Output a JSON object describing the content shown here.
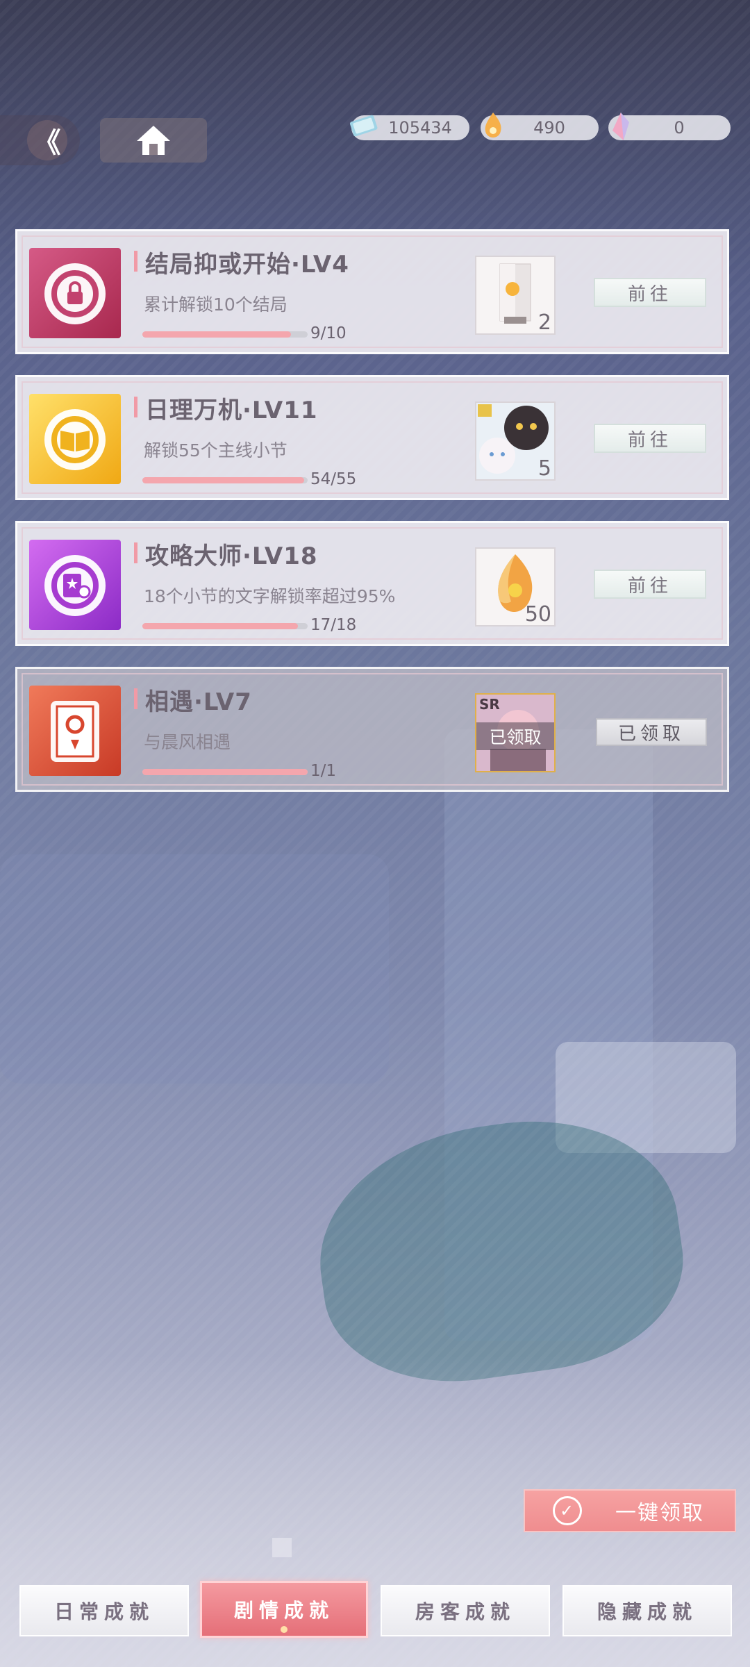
{
  "currencies": [
    {
      "icon": "ticket-icon",
      "value": "105434"
    },
    {
      "icon": "flame-gem-icon",
      "value": "490"
    },
    {
      "icon": "crystal-icon",
      "value": "0"
    }
  ],
  "back_icon": "《",
  "achievements": [
    {
      "title": "结局抑或开始·LV4",
      "desc": "累计解锁10个结局",
      "progress": "9/10",
      "fraction": 0.9,
      "reward_qty": "2",
      "button": "前往",
      "badge_color": "#c2426e"
    },
    {
      "title": "日理万机·LV11",
      "desc": "解锁55个主线小节",
      "progress": "54/55",
      "fraction": 0.98,
      "reward_qty": "5",
      "button": "前往",
      "badge_color": "#f0b21e"
    },
    {
      "title": "攻略大师·LV18",
      "desc": "18个小节的文字解锁率超过95%",
      "progress": "17/18",
      "fraction": 0.94,
      "reward_qty": "50",
      "button": "前往",
      "badge_color": "#a63bd0"
    },
    {
      "title": "相遇·LV7",
      "desc": "与晨风相遇",
      "progress": "1/1",
      "fraction": 1.0,
      "reward_tag": "SR",
      "reward_claimed": "已领取",
      "button": "已领取",
      "badge_color": "#d8462e"
    }
  ],
  "claim_all_label": "一键领取",
  "tabs": [
    "日常成就",
    "剧情成就",
    "房客成就",
    "隐藏成就"
  ],
  "active_tab": "剧情成就"
}
